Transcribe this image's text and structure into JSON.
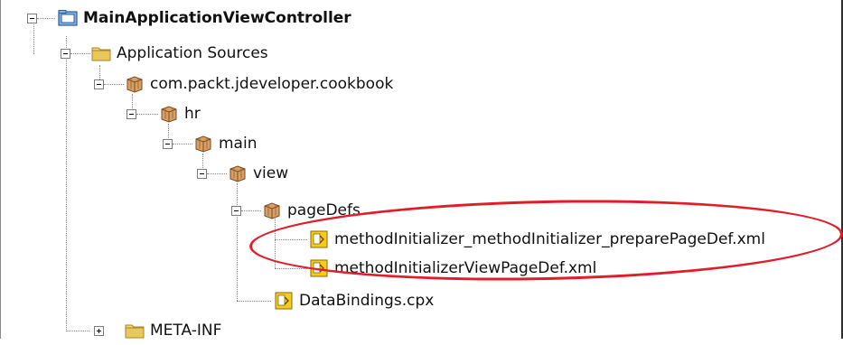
{
  "tree": {
    "project": {
      "label": "MainApplicationViewController",
      "icon": "project-folder-icon",
      "expanded": true
    },
    "app_sources": {
      "label": "Application Sources",
      "icon": "folder-icon",
      "expanded": true
    },
    "pkg_cookbook": {
      "label": "com.packt.jdeveloper.cookbook",
      "icon": "package-icon",
      "expanded": true
    },
    "pkg_hr": {
      "label": "hr",
      "icon": "package-icon",
      "expanded": true
    },
    "pkg_main": {
      "label": "main",
      "icon": "package-icon",
      "expanded": true
    },
    "pkg_view": {
      "label": "view",
      "icon": "package-icon",
      "expanded": true
    },
    "pkg_pagedefs": {
      "label": "pageDefs",
      "icon": "package-icon",
      "expanded": true
    },
    "file_prepare": {
      "label": "methodInitializer_methodInitializer_preparePageDef.xml",
      "icon": "xml-file-icon"
    },
    "file_viewpage": {
      "label": "methodInitializerViewPageDef.xml",
      "icon": "xml-file-icon"
    },
    "file_databindings": {
      "label": "DataBindings.cpx",
      "icon": "xml-file-icon"
    },
    "meta_inf": {
      "label": "META-INF",
      "icon": "folder-icon",
      "expanded": false
    }
  },
  "colors": {
    "folder": "#e8c85a",
    "project_folder": "#6aa4e0",
    "package": "#c98a4a",
    "xml_file": "#f5cc1c",
    "highlight": "#e11d2a"
  }
}
